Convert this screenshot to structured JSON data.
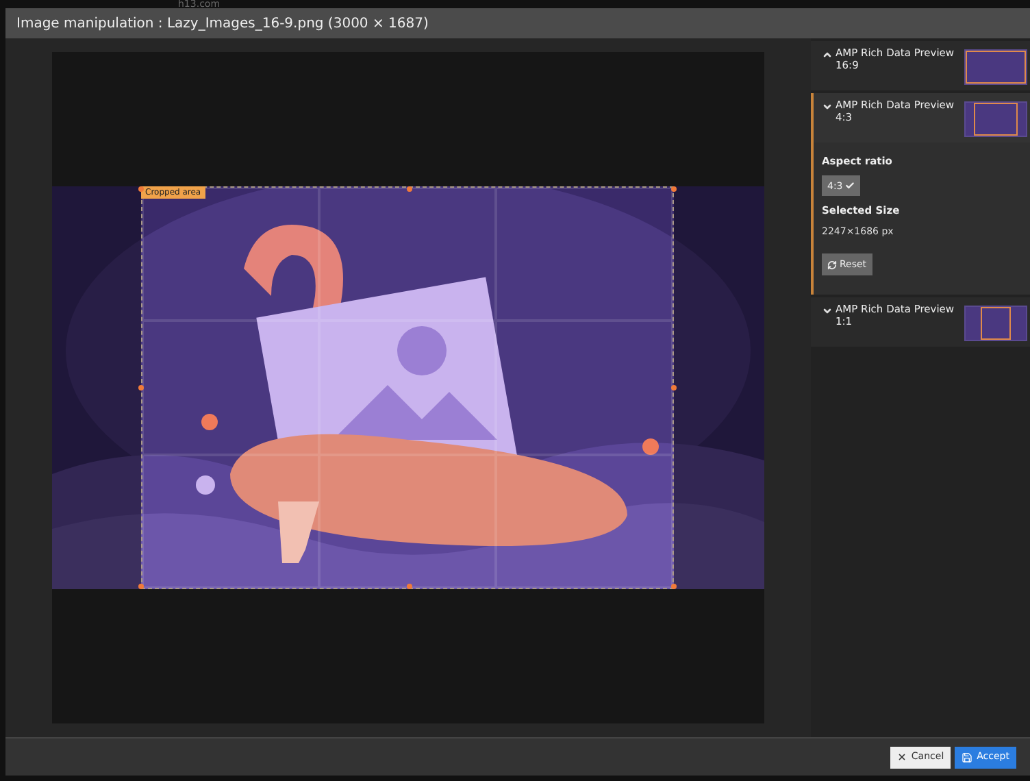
{
  "background_tab": {
    "label": "h13.com"
  },
  "window": {
    "title": "Image manipulation : Lazy_Images_16-9.png (3000 × 1687)"
  },
  "crop": {
    "label": "Cropped area"
  },
  "variants": [
    {
      "title": "AMP Rich Data Preview 16:9",
      "caret_up": true,
      "expanded": false,
      "kind": "wide"
    },
    {
      "title": "AMP Rich Data Preview 4:3",
      "caret_up": false,
      "expanded": true,
      "kind": "standard",
      "details": {
        "aspect_heading": "Aspect ratio",
        "aspect_options": [
          {
            "label": "4:3",
            "selected": true
          }
        ],
        "size_heading": "Selected Size",
        "size_value": "2247×1686 px",
        "reset_label": "Reset"
      }
    },
    {
      "title": "AMP Rich Data Preview 1:1",
      "caret_up": false,
      "expanded": false,
      "kind": "square"
    }
  ],
  "buttons": [
    {
      "label": "Cancel",
      "kind": "cancel"
    },
    {
      "label": "Accept",
      "kind": "primary"
    }
  ]
}
